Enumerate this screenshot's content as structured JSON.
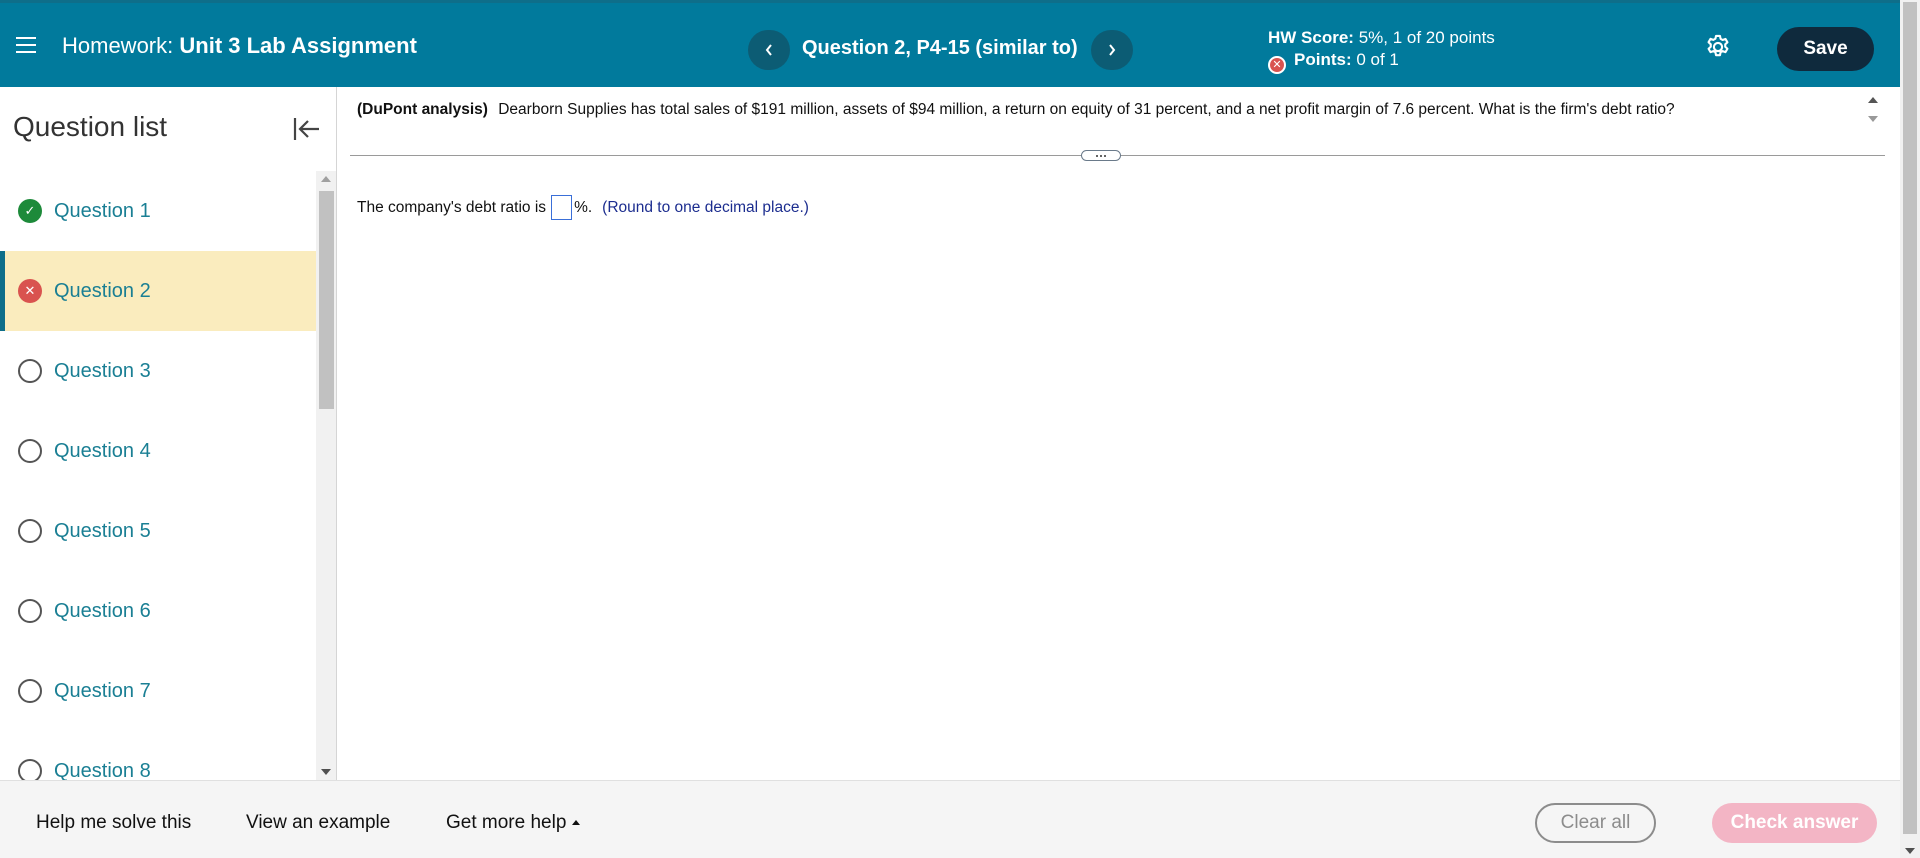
{
  "header": {
    "hw_prefix": "Homework:",
    "hw_name": "Unit 3 Lab Assignment",
    "question_title": "Question 2, P4-15 (similar to)",
    "prev_icon": "chevron-left-icon",
    "next_icon": "chevron-right-icon",
    "hw_score_label": "HW Score:",
    "hw_score_value": "5%, 1 of 20 points",
    "points_label": "Points:",
    "points_value": "0 of 1",
    "save_label": "Save",
    "accent_color": "#017a9c"
  },
  "sidebar": {
    "title": "Question list",
    "items": [
      {
        "label": "Question 1",
        "status": "correct"
      },
      {
        "label": "Question 2",
        "status": "incorrect"
      },
      {
        "label": "Question 3",
        "status": "unanswered"
      },
      {
        "label": "Question 4",
        "status": "unanswered"
      },
      {
        "label": "Question 5",
        "status": "unanswered"
      },
      {
        "label": "Question 6",
        "status": "unanswered"
      },
      {
        "label": "Question 7",
        "status": "unanswered"
      },
      {
        "label": "Question 8",
        "status": "unanswered"
      }
    ]
  },
  "question": {
    "topic": "(DuPont analysis)",
    "text": "Dearborn Supplies has total sales of $191 million, assets of $94 million, a return on equity of 31 percent, and a net profit margin of 7.6 percent.  What is the firm's debt ratio?",
    "answer_prefix": "The company's debt ratio is",
    "answer_value": "",
    "answer_suffix": "%.",
    "answer_hint": "(Round to one decimal place.)"
  },
  "footer": {
    "help_solve": "Help me solve this",
    "view_example": "View an example",
    "more_help": "Get more help",
    "clear_all": "Clear all",
    "check_answer": "Check answer"
  }
}
